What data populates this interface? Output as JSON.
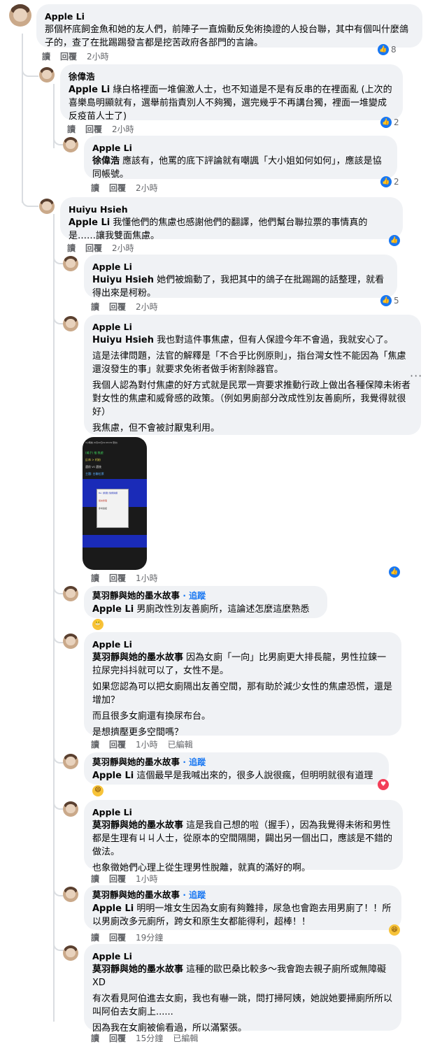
{
  "ui": {
    "read": "讀",
    "reply": "回覆",
    "edited": "已編輯",
    "follow": "· 追蹤",
    "more": "···"
  },
  "comments": [
    {
      "name": "Apple Li",
      "lines": [
        "那個杯底飼金魚和她的友人們，前陣子一直煽動反免術換證的人投台聯，其中有個叫什麼鴿子的，查了在批踢踢發言都是挖苦政府各部門的言論。"
      ],
      "time": "2小時",
      "reactions": "8"
    },
    {
      "name": "徐偉浩",
      "mention": "Apple Li",
      "lines": [
        "綠白格裡面一堆偏激人士，也不知道是不是有反串的在裡面亂 (上次的喜樂島明顯就有，選舉前指責別人不夠獨，選完幾乎不再講台獨，裡面一堆變成反疫苗人士了)"
      ],
      "time": "2小時",
      "reactions": "2"
    },
    {
      "name": "Apple Li",
      "mention": "徐偉浩",
      "lines": [
        "應該有，他罵的底下評論就有嘲諷「大小姐如何如何」，應該是協同帳號。"
      ],
      "time": "2小時",
      "reactions": "2"
    },
    {
      "name": "Huiyu Hsieh",
      "mention": "Apple Li",
      "lines": [
        "我懂他們的焦慮也感謝他們的翻譯，他們幫台聯拉票的事情真的是……讓我雙面焦慮。"
      ],
      "time": "2小時",
      "reactions": ""
    },
    {
      "name": "Apple Li",
      "mention": "Huiyu Hsieh",
      "lines": [
        "她們被煽動了，我把其中的鴿子在批踢踢的話整理，就看得出來是柯粉。"
      ],
      "time": "2小時",
      "reactions": "5"
    },
    {
      "name": "Apple Li",
      "mention": "Huiyu Hsieh",
      "lines": [
        "我也對這件事焦慮，但有人保證今年不會過，我就安心了。",
        "這是法律問題，法官的解釋是「不合乎比例原則」，指台灣女性不能因為「焦慮還沒發生的事」就要求免術者做手術割除器官。",
        "我個人認為對付焦慮的好方式就是民眾一齊要求推動行政上做出各種保障未術者對女性的焦慮和威脅感的政策。（例如男廁部分改成性別友善廁所，我覺得就很好）",
        "我焦慮，但不會被討厭鬼利用。"
      ],
      "time": "1小時",
      "reactions": ""
    },
    {
      "name": "莫羽靜與她的墨水故事",
      "follow": true,
      "mention": "Apple Li",
      "lines": [
        "男廁改性別友善廁所，這論述怎麼這麼熟悉"
      ],
      "time": "",
      "reactions": ""
    },
    {
      "name": "Apple Li",
      "mention": "莫羽靜與她的墨水故事",
      "lines": [
        "因為女廁「一向」比男廁更大排長龍，男性拉鍊一拉尿完抖抖就可以了，女性不是。",
        "如果您認為可以把女廁隔出友善空間，那有助於減少女性的焦慮恐慌，還是增加？",
        "而且很多女廁還有換尿布台。",
        "是想擠壓更多空間嗎？"
      ],
      "time": "1小時",
      "edited": true,
      "reactions": ""
    },
    {
      "name": "莫羽靜與她的墨水故事",
      "follow": true,
      "mention": "Apple Li",
      "lines": [
        "這個最早是我喊出來的，很多人說很瘋，但明明就很有道理"
      ],
      "time": "1小時",
      "reactions": ""
    },
    {
      "name": "Apple Li",
      "mention": "莫羽靜與她的墨水故事",
      "lines": [
        "這是我自己想的啦（握手），因為我覺得未術和男性都是生理有ㄐㄐ人士，從原本的空間隔開，闢出另一個出口，應該是不錯的做法。",
        "也象徵她們心理上從生理男性脫離，就真的滿好的啊。"
      ],
      "time": "1小時",
      "reactions": ""
    },
    {
      "name": "莫羽靜與她的墨水故事",
      "follow": true,
      "mention": "Apple Li",
      "lines": [
        "明明一堆女生因為女廁有夠難排，尿急也會跑去用男廁了！！所以男廁改多元廁所，跨女和原生女都能得利，超棒！！"
      ],
      "time": "19分鐘",
      "reactions": ""
    },
    {
      "name": "Apple Li",
      "mention": "莫羽靜與她的墨水故事",
      "lines": [
        "這種的歐巴桑比較多～我會跑去親子廁所或無障礙XD",
        "有次看見阿伯進去女廁，我也有嚇一跳，問打掃阿姨，她說她要掃廁所所以叫阿伯去女廁上......",
        "因為我在女廁被偷看過，所以滿緊張。"
      ],
      "time": "15分鐘",
      "edited": true,
      "reactions": ""
    }
  ],
  "screenshot": {
    "top_line": "3小時前 (5月22日19:45:09 發文)",
    "rows": [
      "(鴿子) 推:焦慮",
      "反串 > 柯粉",
      "選前 vs 選後",
      "主題: 台聯拉票"
    ],
    "popup_lines": [
      "Re: [新聞] 免術換證",
      "留言整理",
      "參考連結"
    ]
  }
}
